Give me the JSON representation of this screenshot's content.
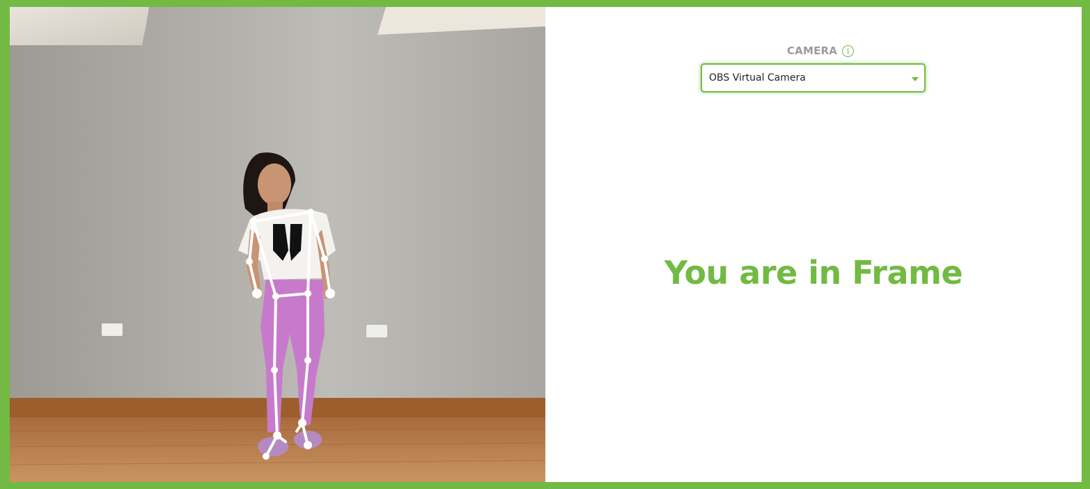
{
  "camera": {
    "label": "CAMERA",
    "info_icon": "info-icon",
    "selected_device": "OBS Virtual Camera"
  },
  "status": {
    "message": "You are in Frame"
  },
  "feed": {
    "overlay": "pose-skeleton"
  },
  "colors": {
    "accent": "#72ba43",
    "label_gray": "#9c9c9c"
  }
}
